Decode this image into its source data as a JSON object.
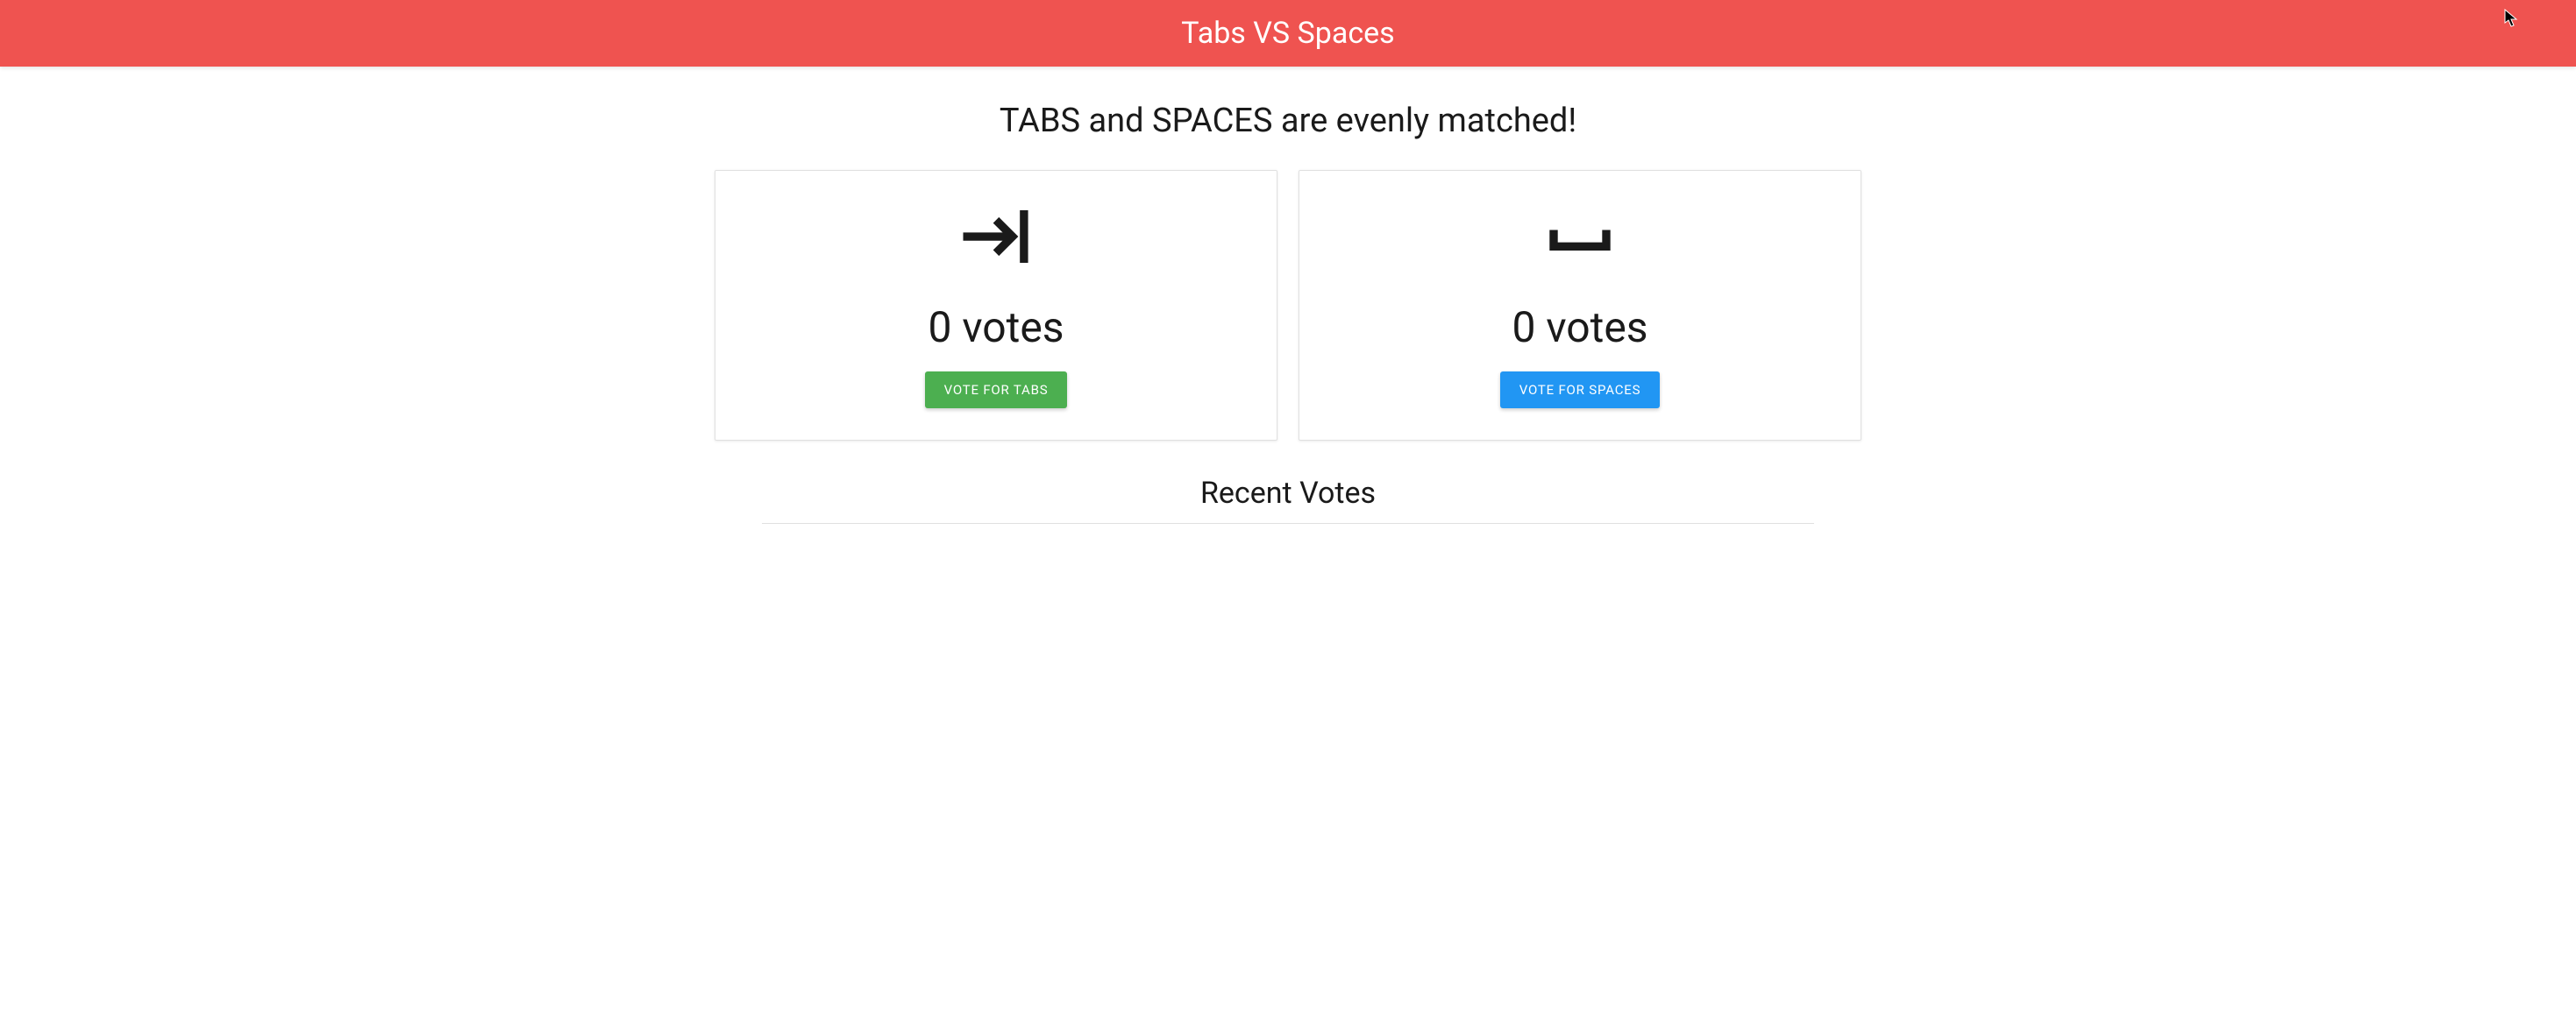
{
  "header": {
    "title": "Tabs VS Spaces"
  },
  "status": {
    "heading": "TABS and SPACES are evenly matched!"
  },
  "cards": {
    "tabs": {
      "votes_label": "0 votes",
      "button_label": "VOTE FOR TABS"
    },
    "spaces": {
      "votes_label": "0 votes",
      "button_label": "VOTE FOR SPACES"
    }
  },
  "recent": {
    "heading": "Recent Votes"
  },
  "colors": {
    "header_bg": "#ef5350",
    "btn_green": "#4caf50",
    "btn_blue": "#2196f3"
  }
}
